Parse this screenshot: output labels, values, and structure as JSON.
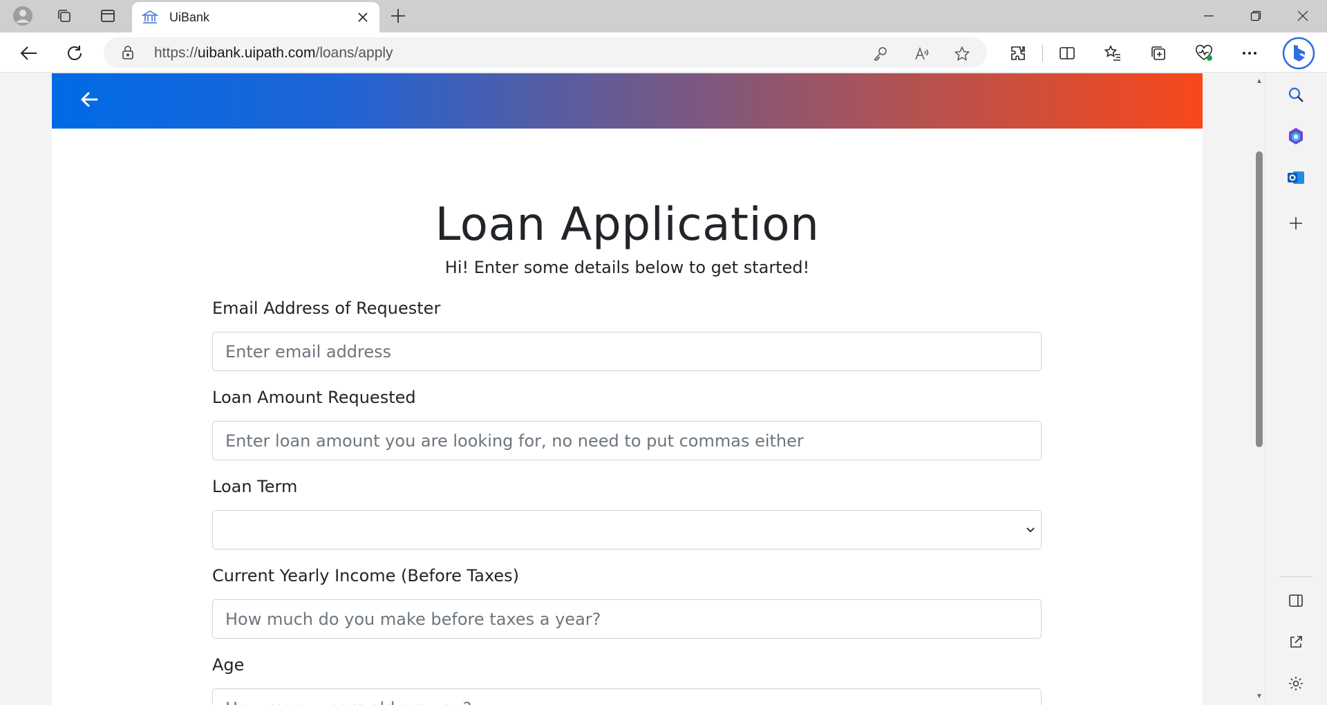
{
  "browser": {
    "tab": {
      "title": "UiBank"
    },
    "url": {
      "scheme": "https://",
      "host": "uibank.uipath.com",
      "path": "/loans/apply"
    }
  },
  "page": {
    "title": "Loan Application",
    "subtitle": "Hi! Enter some details below to get started!",
    "fields": {
      "email": {
        "label": "Email Address of Requester",
        "placeholder": "Enter email address",
        "value": ""
      },
      "amount": {
        "label": "Loan Amount Requested",
        "placeholder": "Enter loan amount you are looking for, no need to put commas either",
        "value": ""
      },
      "term": {
        "label": "Loan Term",
        "selected": ""
      },
      "income": {
        "label": "Current Yearly Income (Before Taxes)",
        "placeholder": "How much do you make before taxes a year?",
        "value": ""
      },
      "age": {
        "label": "Age",
        "placeholder": "How many years old are you?",
        "value": ""
      }
    }
  },
  "colors": {
    "hero_start": "#006be6",
    "hero_end": "#f9481a"
  }
}
